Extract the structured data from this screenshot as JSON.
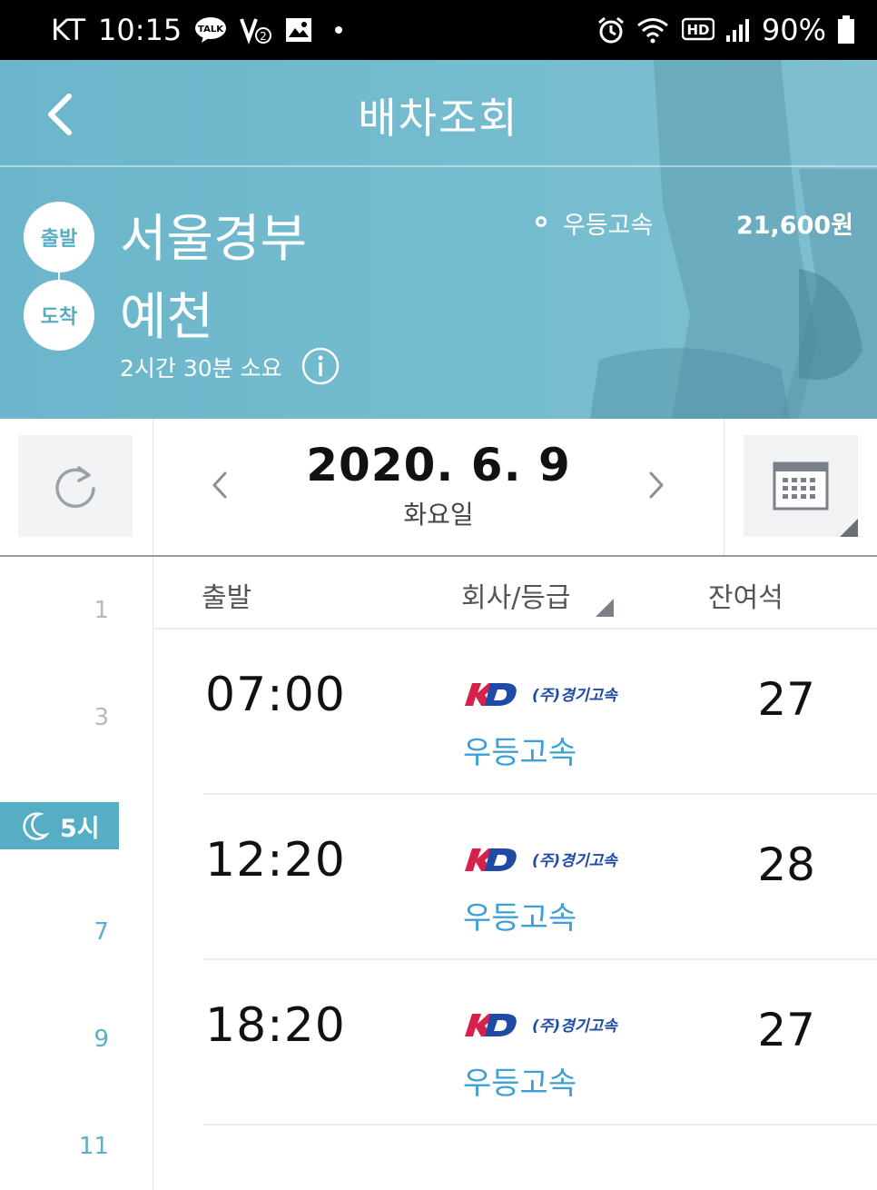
{
  "status_bar": {
    "carrier": "KT",
    "time": "10:15",
    "battery": "90%"
  },
  "header": {
    "title": "배차조회",
    "departure_badge": "출발",
    "arrival_badge": "도착",
    "departure": "서울경부",
    "arrival": "예천",
    "duration": "2시간 30분 소요",
    "company": "우등고속",
    "fare": "21,600원"
  },
  "date_bar": {
    "date": "2020. 6. 9",
    "weekday": "화요일"
  },
  "hour_rail": {
    "ticks": [
      "1",
      "3",
      "7",
      "9",
      "11"
    ],
    "current_label": "5시"
  },
  "table": {
    "headers": {
      "departure": "출발",
      "company_grade": "회사/등급",
      "seats": "잔여석"
    },
    "rows": [
      {
        "time": "07:00",
        "company": "(주)경기고속",
        "logo_mark": "KD",
        "grade": "우등고속",
        "seats": "27"
      },
      {
        "time": "12:20",
        "company": "(주)경기고속",
        "logo_mark": "KD",
        "grade": "우등고속",
        "seats": "28"
      },
      {
        "time": "18:20",
        "company": "(주)경기고속",
        "logo_mark": "KD",
        "grade": "우등고속",
        "seats": "27"
      }
    ]
  },
  "colors": {
    "header_bg": "#6cb6cb",
    "accent": "#55aec4",
    "grade_text": "#3e9fd8",
    "logo_red": "#d6224a",
    "logo_blue": "#1f4aa5"
  },
  "icons": {
    "back": "chevron-left-icon",
    "info": "info-icon",
    "refresh": "refresh-icon",
    "prev": "chevron-left-icon",
    "next": "chevron-right-icon",
    "calendar": "calendar-icon",
    "moon": "moon-icon"
  }
}
